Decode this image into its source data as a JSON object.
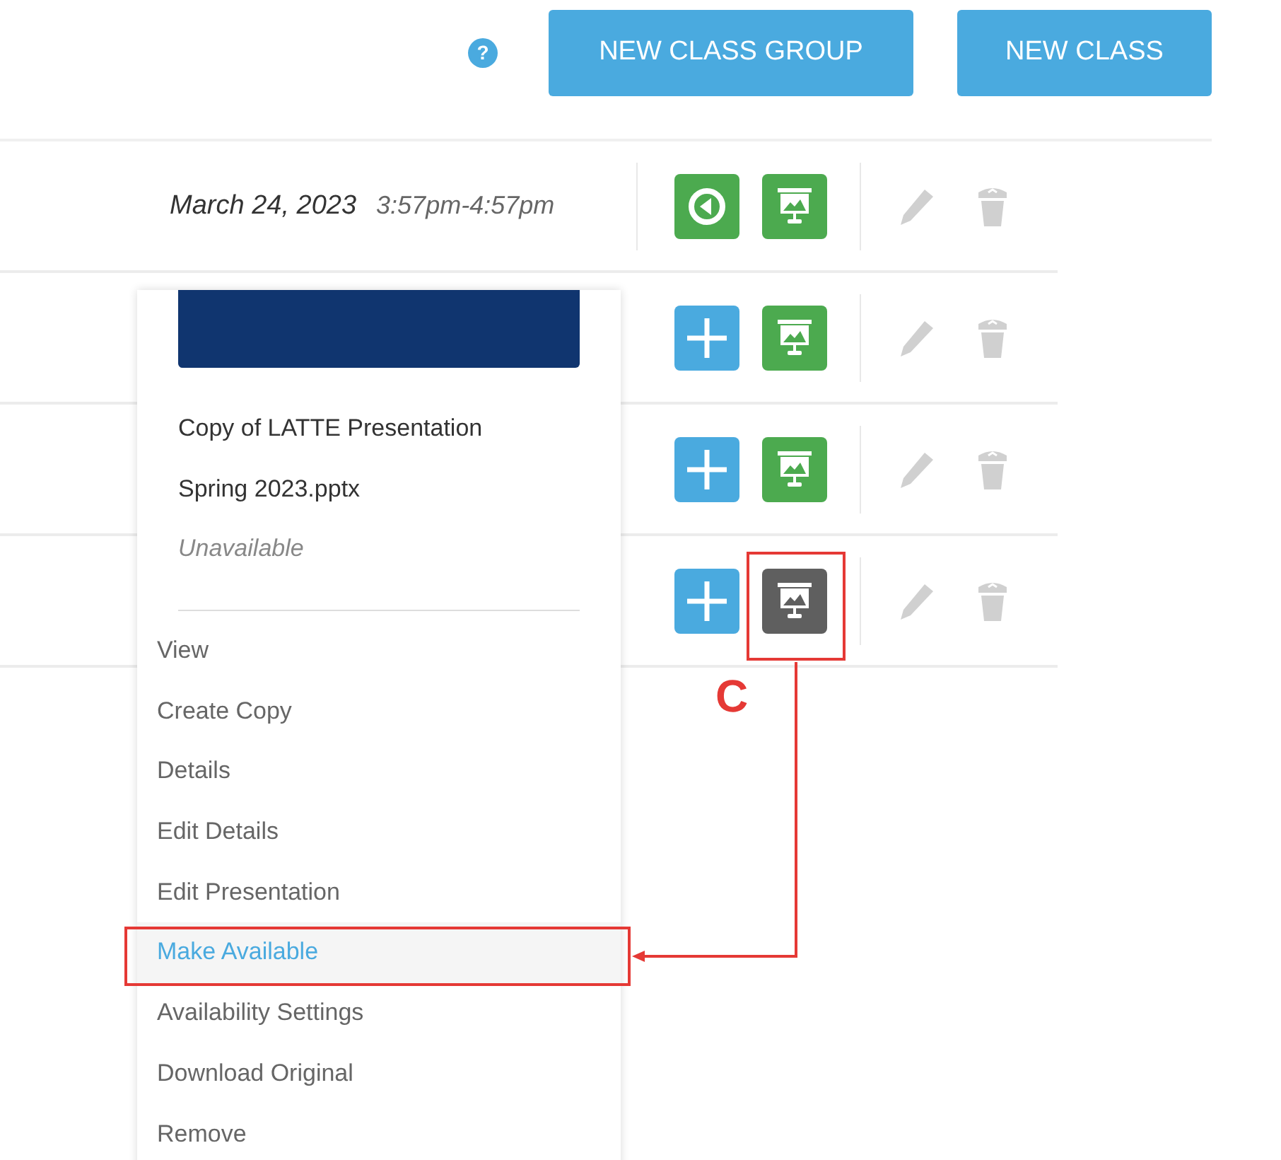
{
  "header": {
    "help": "?",
    "buttons": [
      "NEW CLASS GROUP",
      "NEW CLASS"
    ]
  },
  "rows": [
    {
      "date": "March 24, 2023",
      "time": "3:57pm-4:57pm",
      "kind": "start",
      "presentation_available": true
    },
    {
      "kind": "add",
      "presentation_available": true
    },
    {
      "kind": "add",
      "presentation_available": true
    },
    {
      "kind": "add",
      "presentation_available": false
    }
  ],
  "dropdown": {
    "file_name_lines": [
      "Copy of LATTE Presentation",
      "Spring 2023.pptx"
    ],
    "status": "Unavailable",
    "items": [
      {
        "label": "View",
        "selected": false
      },
      {
        "label": "Create Copy",
        "selected": false
      },
      {
        "label": "Details",
        "selected": false
      },
      {
        "label": "Edit Details",
        "selected": false
      },
      {
        "label": "Edit Presentation",
        "selected": false
      },
      {
        "label": "Make Available",
        "selected": true
      },
      {
        "label": "Availability Settings",
        "selected": false
      },
      {
        "label": "Download Original",
        "selected": false
      },
      {
        "label": "Remove",
        "selected": false
      }
    ]
  },
  "annotation": {
    "label": "C"
  }
}
